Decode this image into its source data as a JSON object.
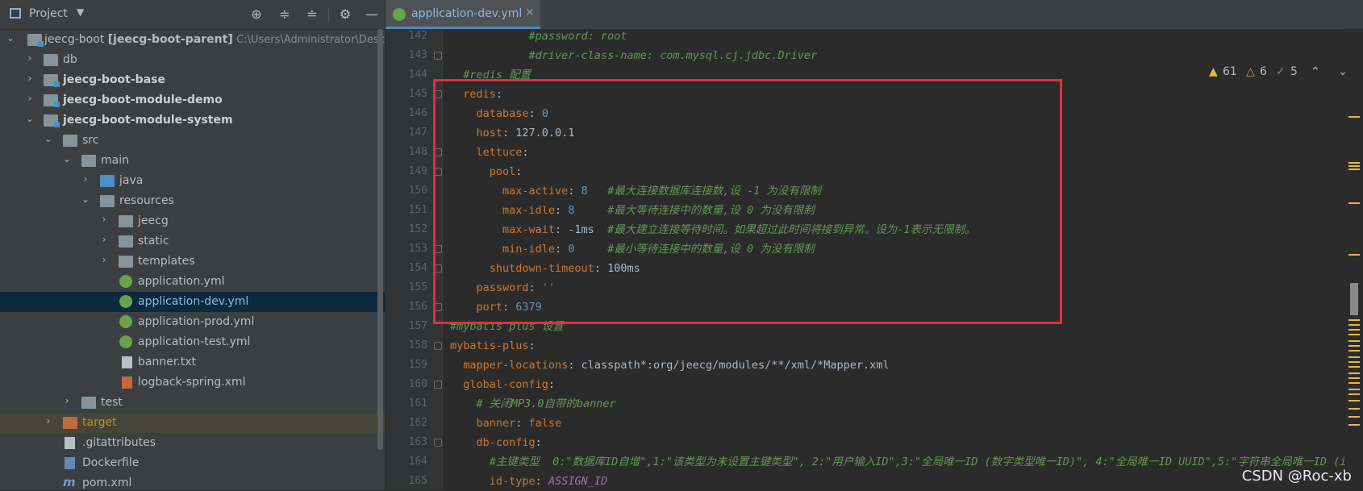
{
  "project": {
    "title": "Project",
    "tree": [
      {
        "label": "jeecg-boot",
        "bold_suffix": "[jeecg-boot-parent]",
        "path": "C:\\Users\\Administrator\\Deskto"
      },
      {
        "label": "db"
      },
      {
        "label": "jeecg-boot-base"
      },
      {
        "label": "jeecg-boot-module-demo"
      },
      {
        "label": "jeecg-boot-module-system"
      },
      {
        "label": "src"
      },
      {
        "label": "main"
      },
      {
        "label": "java"
      },
      {
        "label": "resources"
      },
      {
        "label": "jeecg"
      },
      {
        "label": "static"
      },
      {
        "label": "templates"
      },
      {
        "label": "application.yml"
      },
      {
        "label": "application-dev.yml"
      },
      {
        "label": "application-prod.yml"
      },
      {
        "label": "application-test.yml"
      },
      {
        "label": "banner.txt"
      },
      {
        "label": "logback-spring.xml"
      },
      {
        "label": "test"
      },
      {
        "label": "target"
      },
      {
        "label": ".gitattributes"
      },
      {
        "label": "Dockerfile"
      },
      {
        "label": "pom.xml"
      }
    ]
  },
  "editor": {
    "tab_label": "application-dev.yml",
    "inspections": {
      "warnings": "61",
      "weak": "6",
      "ok": "5"
    },
    "lines": [
      {
        "n": "142",
        "t": [
          [
            "c",
            "            #password: root"
          ]
        ]
      },
      {
        "n": "143",
        "t": [
          [
            "c",
            "            #driver-class-name: com.mysql.cj.jdbc.Driver"
          ]
        ]
      },
      {
        "n": "144",
        "t": [
          [
            "c",
            "  #redis 配置"
          ]
        ]
      },
      {
        "n": "145",
        "t": [
          [
            "k",
            "  redis"
          ],
          [
            "p",
            ":"
          ]
        ]
      },
      {
        "n": "146",
        "t": [
          [
            "k",
            "    database"
          ],
          [
            "p",
            ": "
          ],
          [
            "n",
            "0"
          ]
        ]
      },
      {
        "n": "147",
        "t": [
          [
            "k",
            "    host"
          ],
          [
            "p",
            ": 127.0.0.1"
          ]
        ]
      },
      {
        "n": "148",
        "t": [
          [
            "k",
            "    lettuce"
          ],
          [
            "p",
            ":"
          ]
        ]
      },
      {
        "n": "149",
        "t": [
          [
            "k",
            "      pool"
          ],
          [
            "p",
            ":"
          ]
        ]
      },
      {
        "n": "150",
        "t": [
          [
            "k",
            "        max-active"
          ],
          [
            "p",
            ": "
          ],
          [
            "n",
            "8"
          ],
          [
            "c",
            "   #最大连接数据库连接数,设 -1 为没有限制"
          ]
        ]
      },
      {
        "n": "151",
        "t": [
          [
            "k",
            "        max-idle"
          ],
          [
            "p",
            ": "
          ],
          [
            "n",
            "8"
          ],
          [
            "c",
            "     #最大等待连接中的数量,设 0 为没有限制"
          ]
        ]
      },
      {
        "n": "152",
        "t": [
          [
            "k",
            "        max-wait"
          ],
          [
            "p",
            ": -1ms"
          ],
          [
            "c",
            "  #最大建立连接等待时间。如果超过此时间将接到异常。设为-1表示无限制。"
          ]
        ]
      },
      {
        "n": "153",
        "t": [
          [
            "k",
            "        min-idle"
          ],
          [
            "p",
            ": "
          ],
          [
            "n",
            "0"
          ],
          [
            "c",
            "     #最小等待连接中的数量,设 0 为没有限制"
          ]
        ]
      },
      {
        "n": "154",
        "t": [
          [
            "k",
            "      shutdown-timeout"
          ],
          [
            "p",
            ": 100ms"
          ]
        ]
      },
      {
        "n": "155",
        "t": [
          [
            "k",
            "    password"
          ],
          [
            "p",
            ": "
          ],
          [
            "s",
            "''"
          ]
        ]
      },
      {
        "n": "156",
        "t": [
          [
            "k",
            "    port"
          ],
          [
            "p",
            ": "
          ],
          [
            "n",
            "6379"
          ]
        ]
      },
      {
        "n": "157",
        "t": [
          [
            "c",
            "#mybatis plus 设置"
          ]
        ]
      },
      {
        "n": "158",
        "t": [
          [
            "k",
            "mybatis-plus"
          ],
          [
            "p",
            ":"
          ]
        ]
      },
      {
        "n": "159",
        "t": [
          [
            "k",
            "  mapper-locations"
          ],
          [
            "p",
            ": classpath*:org/jeecg/modules/**/xml/*Mapper.xml"
          ]
        ]
      },
      {
        "n": "160",
        "t": [
          [
            "k",
            "  global-config"
          ],
          [
            "p",
            ":"
          ]
        ]
      },
      {
        "n": "161",
        "t": [
          [
            "c",
            "    # 关闭MP3.0自带的banner"
          ]
        ]
      },
      {
        "n": "162",
        "t": [
          [
            "k",
            "    banner"
          ],
          [
            "p",
            ": "
          ],
          [
            "k",
            "false"
          ]
        ]
      },
      {
        "n": "163",
        "t": [
          [
            "k",
            "    db-config"
          ],
          [
            "p",
            ":"
          ]
        ]
      },
      {
        "n": "164",
        "t": [
          [
            "c",
            "      #主键类型  0:\"数据库ID自增\",1:\"该类型为未设置主键类型\", 2:\"用户输入ID\",3:\"全局唯一ID (数字类型唯一ID)\", 4:\"全局唯一ID UUID\",5:\"字符串全局唯一ID (i"
          ]
        ]
      },
      {
        "n": "165",
        "t": [
          [
            "k",
            "      id-type"
          ],
          [
            "p",
            ": "
          ],
          [
            "e",
            "ASSIGN_ID"
          ]
        ]
      }
    ]
  },
  "watermark": "CSDN @Roc-xb",
  "colors": {
    "accent": "#4a88c7",
    "highlight_box": "#e0313b",
    "key": "#cc7832",
    "comment": "#629755",
    "number": "#6897bb"
  }
}
